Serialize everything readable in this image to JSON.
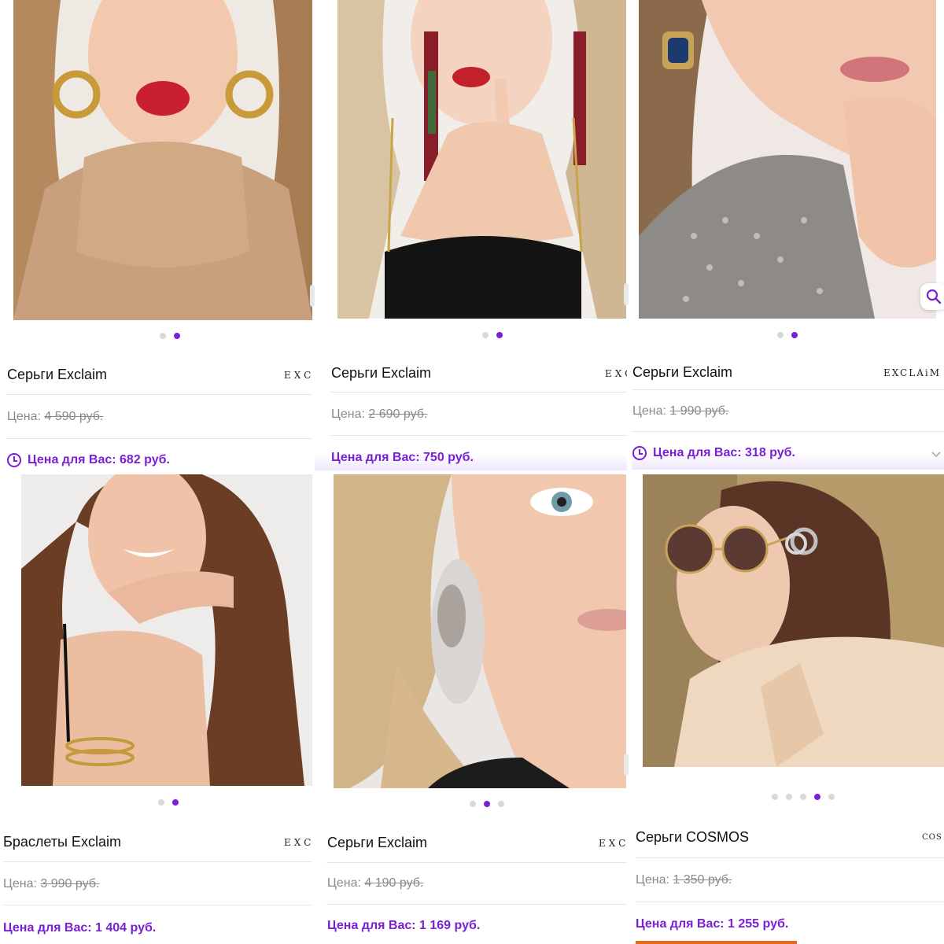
{
  "products": [
    {
      "title": "Серьги Exclaim",
      "brand": "EXCL",
      "price_label": "Цена:",
      "old_price": "4 590 руб.",
      "sale_label": "Цена для Вас: 682 руб.",
      "slides": 2,
      "active_slide": 2
    },
    {
      "title": "Серьги Exclaim",
      "brand": "EXCl",
      "price_label": "Цена:",
      "old_price": "2 690 руб.",
      "sale_label": "Цена для Вас: 750 руб.",
      "slides": 2,
      "active_slide": 2
    },
    {
      "title": "Серьги Exclaim",
      "brand": "EXCLAiM",
      "price_label": "Цена:",
      "old_price": "1 990 руб.",
      "sale_label": "Цена для Вас: 318 руб.",
      "slides": 2,
      "active_slide": 2
    },
    {
      "title": "Браслеты Exclaim",
      "brand": "EXCL",
      "price_label": "Цена:",
      "old_price": "3 990 руб.",
      "sale_label": "Цена для Вас: 1 404 руб.",
      "slides": 2,
      "active_slide": 2
    },
    {
      "title": "Серьги Exclaim",
      "brand": "EXCL/",
      "price_label": "Цена:",
      "old_price": "4 190 руб.",
      "sale_label": "Цена для Вас: 1 169 руб.",
      "slides": 3,
      "active_slide": 2
    },
    {
      "title": "Серьги COSMOS",
      "brand": "COS",
      "price_label": "Цена:",
      "old_price": "1 350 руб.",
      "sale_label": "Цена для Вас: 1 255 руб.",
      "slides": 5,
      "active_slide": 4
    }
  ],
  "icons": {
    "search": "search-icon",
    "clock": "clock-icon",
    "chevron": "chevron-down-icon"
  },
  "colors": {
    "accent": "#7a1fd6",
    "muted": "#8a8a8a",
    "dot_inactive": "#d8d8d8"
  }
}
